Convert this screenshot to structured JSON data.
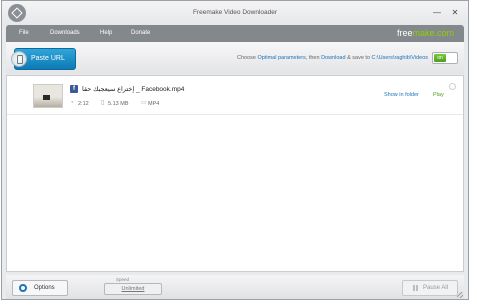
{
  "window": {
    "title": "Freemake Video Downloader"
  },
  "controls": {
    "minimize": "—",
    "close": "✕"
  },
  "menu": {
    "items": [
      {
        "label": "File"
      },
      {
        "label": "Downloads"
      },
      {
        "label": "Help"
      },
      {
        "label": "Donate"
      }
    ],
    "brand_main": "free",
    "brand_accent": "make.com"
  },
  "toolbar": {
    "paste_label": "Paste URL",
    "info_prefix": "Choose ",
    "info_params": "Optimal parameters",
    "info_mid": ", then ",
    "info_download": "Download",
    "info_save": " & save to ",
    "info_path": "C:\\Users\\raghib\\Videos",
    "toggle_label": "on"
  },
  "downloads": [
    {
      "title": "إختراع سيعجبك حقا _ Facebook.mp4",
      "duration": "2:12",
      "size": "5.13 MB",
      "format": "MP4",
      "show_folder": "Show in folder",
      "play": "Play"
    }
  ],
  "statusbar": {
    "options_label": "Options",
    "speed_label": "Speed",
    "speed_value": "Unlimited",
    "pause_all_label": "Pause All"
  },
  "icons": {
    "app_logo": "freemake-logo-icon",
    "paste": "paste-clipboard-icon",
    "facebook": "facebook-icon",
    "clock": "clock-icon",
    "filesize": "file-icon",
    "format": "film-icon",
    "settings": "gear-icon",
    "pause": "pause-icon"
  },
  "colors": {
    "accent_blue": "#0e79b5",
    "link_blue": "#1a73b8",
    "brand_green": "#8ed000",
    "menubar": "#83888d"
  }
}
